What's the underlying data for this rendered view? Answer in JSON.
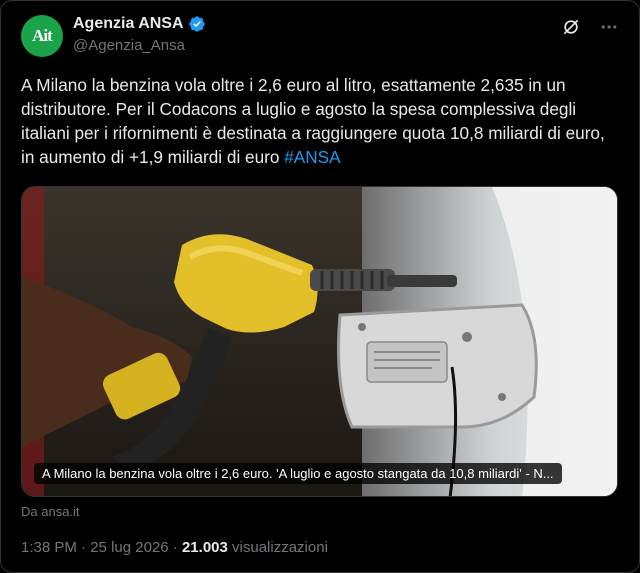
{
  "account": {
    "name": "Agenzia ANSA",
    "handle": "@Agenzia_Ansa",
    "avatar_text": "Ait"
  },
  "tweet": {
    "text": "A Milano la benzina vola oltre i 2,6 euro al litro, esattamente 2,635 in un distributore. Per il Codacons a luglio e agosto la spesa complessiva degli italiani per i rifornimenti è destinata a raggiungere quota 10,8 miliardi di euro, in aumento di +1,9 miliardi di euro ",
    "hashtag": "#ANSA"
  },
  "media": {
    "caption": "A Milano la benzina vola oltre i 2,6 euro. 'A luglio e agosto stangata da 10,8 miliardi' - N..."
  },
  "link_source": "Da ansa.it",
  "footer": {
    "time": "1:38 PM",
    "date": "25 lug 2026",
    "views_count": "21.003",
    "views_label": "visualizzazioni"
  },
  "icons": {
    "verified": "verified-badge-icon",
    "grok": "grok-icon",
    "more": "more-options-icon"
  },
  "colors": {
    "accent": "#1d9bf0",
    "avatar_bg": "#1ba34a",
    "nozzle": "#e8c22a"
  }
}
